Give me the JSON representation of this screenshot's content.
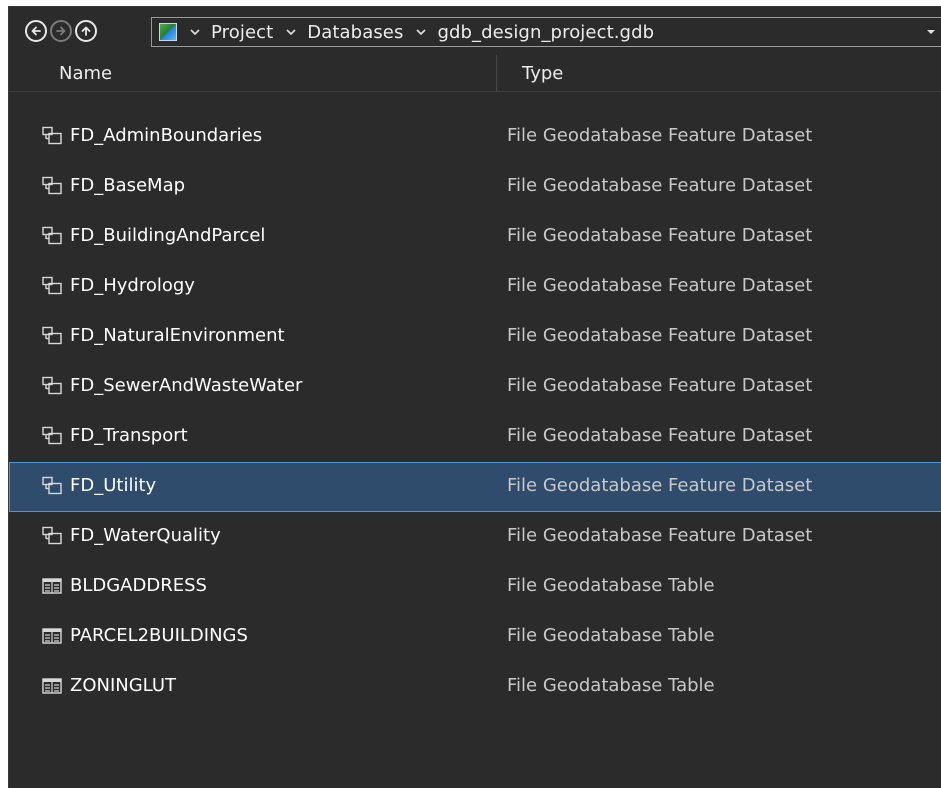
{
  "navigation": {
    "back_icon": "back-arrow-icon",
    "forward_icon": "forward-arrow-icon",
    "up_icon": "up-arrow-icon",
    "location_icon": "project-map-icon",
    "breadcrumbs": [
      {
        "label": "Project"
      },
      {
        "label": "Databases"
      },
      {
        "label": "gdb_design_project.gdb"
      }
    ]
  },
  "columns": {
    "name": "Name",
    "type": "Type"
  },
  "items": [
    {
      "name": "FD_AdminBoundaries",
      "type": "File Geodatabase Feature Dataset",
      "icon": "feature-dataset-icon",
      "selected": false
    },
    {
      "name": "FD_BaseMap",
      "type": "File Geodatabase Feature Dataset",
      "icon": "feature-dataset-icon",
      "selected": false
    },
    {
      "name": "FD_BuildingAndParcel",
      "type": "File Geodatabase Feature Dataset",
      "icon": "feature-dataset-icon",
      "selected": false
    },
    {
      "name": "FD_Hydrology",
      "type": "File Geodatabase Feature Dataset",
      "icon": "feature-dataset-icon",
      "selected": false
    },
    {
      "name": "FD_NaturalEnvironment",
      "type": "File Geodatabase Feature Dataset",
      "icon": "feature-dataset-icon",
      "selected": false
    },
    {
      "name": "FD_SewerAndWasteWater",
      "type": "File Geodatabase Feature Dataset",
      "icon": "feature-dataset-icon",
      "selected": false
    },
    {
      "name": "FD_Transport",
      "type": "File Geodatabase Feature Dataset",
      "icon": "feature-dataset-icon",
      "selected": false
    },
    {
      "name": "FD_Utility",
      "type": "File Geodatabase Feature Dataset",
      "icon": "feature-dataset-icon",
      "selected": true
    },
    {
      "name": "FD_WaterQuality",
      "type": "File Geodatabase Feature Dataset",
      "icon": "feature-dataset-icon",
      "selected": false
    },
    {
      "name": "BLDGADDRESS",
      "type": "File Geodatabase Table",
      "icon": "table-icon",
      "selected": false
    },
    {
      "name": "PARCEL2BUILDINGS",
      "type": "File Geodatabase Table",
      "icon": "table-icon",
      "selected": false
    },
    {
      "name": "ZONINGLUT",
      "type": "File Geodatabase Table",
      "icon": "table-icon",
      "selected": false
    }
  ],
  "colors": {
    "background": "#2b2b2b",
    "selection_fill": "#2f4c6d",
    "selection_border": "#4f95d4",
    "text_primary": "#ffffff",
    "text_secondary": "#c8c8c8"
  }
}
